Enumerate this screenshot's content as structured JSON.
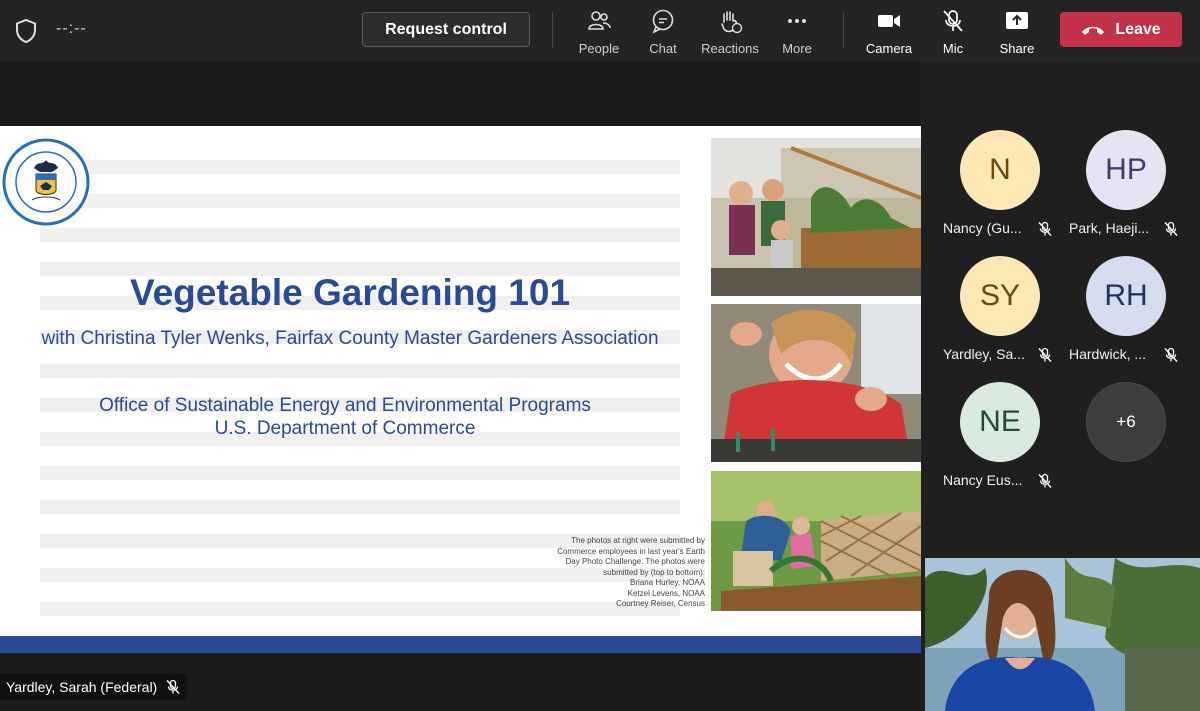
{
  "toolbar": {
    "timer": "--:--",
    "request_control": "Request control",
    "people": "People",
    "chat": "Chat",
    "reactions": "Reactions",
    "more": "More",
    "camera": "Camera",
    "mic": "Mic",
    "share": "Share",
    "leave": "Leave"
  },
  "slide": {
    "title": "Vegetable Gardening 101",
    "subtitle": "with Christina Tyler Wenks, Fairfax County Master Gardeners Association",
    "office_line1": "Office of Sustainable Energy and Environmental Programs",
    "office_line2": "U.S. Department of Commerce",
    "credits": [
      "The photos at right were submitted by",
      "Commerce employees in last year's Earth",
      "Day Photo Challenge. The photos were",
      "submitted by (top to bottom):",
      "Briana Hurley, NOAA",
      "Ketzel Levens, NOAA",
      "Courtney Reiser, Census"
    ],
    "seal_text": "DEPARTMENT OF COMMERCE · UNITED STATES OF AMERICA"
  },
  "presenter": {
    "name": "Yardley, Sarah (Federal)"
  },
  "participants": [
    {
      "initials": "N",
      "name": "Nancy (Gu...",
      "bg": "#fbe8b4",
      "fg": "#6b4a0c"
    },
    {
      "initials": "HP",
      "name": "Park, Haeji...",
      "bg": "#e6e4f2",
      "fg": "#3f3d6e"
    },
    {
      "initials": "SY",
      "name": "Yardley, Sa...",
      "bg": "#fbe8b4",
      "fg": "#6b4a0c"
    },
    {
      "initials": "RH",
      "name": "Hardwick, ...",
      "bg": "#d4dcf0",
      "fg": "#22325f"
    },
    {
      "initials": "NE",
      "name": "Nancy Eus...",
      "bg": "#dbeae0",
      "fg": "#234a33"
    },
    {
      "initials": "+6",
      "name": "",
      "bg": "#3d3d3d",
      "fg": "#ffffff"
    }
  ],
  "colors": {
    "accent_slide": "#2b4a96",
    "leave": "#c4314b",
    "toolbar": "#242424"
  }
}
